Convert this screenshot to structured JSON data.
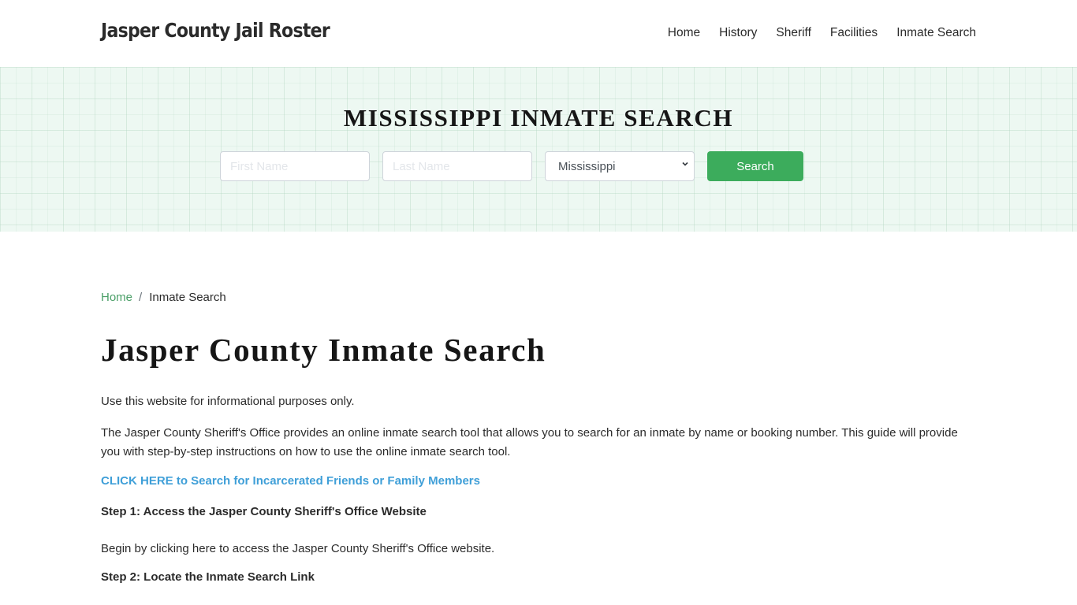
{
  "header": {
    "brand": "Jasper County Jail Roster",
    "nav": [
      {
        "label": "Home"
      },
      {
        "label": "History"
      },
      {
        "label": "Sheriff"
      },
      {
        "label": "Facilities"
      },
      {
        "label": "Inmate Search"
      }
    ]
  },
  "hero": {
    "title": "MISSISSIPPI INMATE SEARCH",
    "first_name": {
      "value": "",
      "placeholder": "First Name"
    },
    "last_name": {
      "value": "",
      "placeholder": "Last Name"
    },
    "state_select": {
      "selected": "Mississippi",
      "icon": "chevron-down-icon"
    },
    "search_label": "Search",
    "colors": {
      "background": "#edf8f2",
      "button": "#3cac5c"
    }
  },
  "breadcrumb": {
    "home": "Home",
    "separator": "/",
    "current": "Inmate Search"
  },
  "main": {
    "title": "Jasper County Inmate Search",
    "intro": "Use this website for informational purposes only.",
    "description": "The Jasper County Sheriff's Office provides an online inmate search tool that allows you to search for an inmate by name or booking number. This guide will provide you with step-by-step instructions on how to use the online inmate search tool.",
    "cta_link": "CLICK HERE to Search for Incarcerated Friends or Family Members",
    "step1_heading": "Step 1: Access the Jasper County Sheriff's Office Website",
    "step1_text": "Begin by clicking here to access the Jasper County Sheriff's Office website.",
    "step2_heading": "Step 2: Locate the Inmate Search Link",
    "colors": {
      "link": "#3f9fd8",
      "breadcrumb_link": "#4a9f67"
    }
  }
}
